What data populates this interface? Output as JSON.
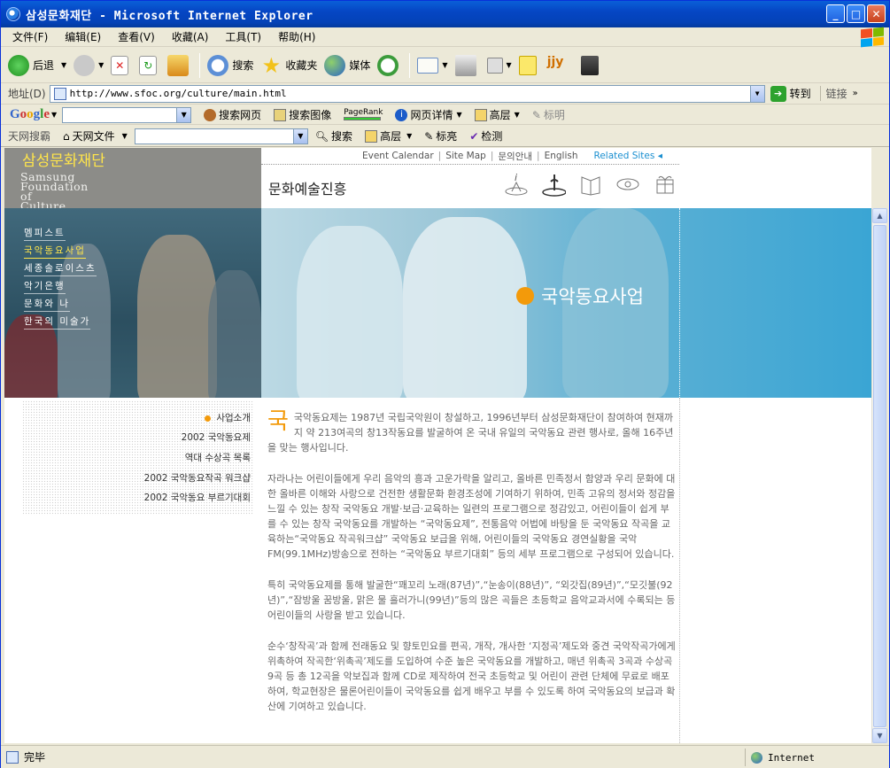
{
  "window": {
    "title": "삼성문화재단 - Microsoft Internet Explorer"
  },
  "menu": [
    "文件(F)",
    "编辑(E)",
    "查看(V)",
    "收藏(A)",
    "工具(T)",
    "帮助(H)"
  ],
  "toolbar": {
    "back": "后退",
    "search": "搜索",
    "favorites": "收藏夹",
    "media": "媒体"
  },
  "address": {
    "label": "地址(D)",
    "url": "http://www.sfoc.org/culture/main.html",
    "go": "转到",
    "links": "链接"
  },
  "google_bar": {
    "logo": "Google",
    "search_web": "搜索网页",
    "search_images": "搜索图像",
    "pagerank": "PageRank",
    "page_info": "网页详情",
    "up": "高层",
    "highlight": "标明"
  },
  "tianwang_bar": {
    "label": "天网搜霸",
    "files": "天网文件",
    "search": "搜索",
    "up": "高层",
    "highlight": "标亮",
    "check": "检测"
  },
  "site": {
    "logo_ko": "삼성문화재단",
    "logo_en": [
      "Samsung",
      "Foundation",
      "of",
      "Culture"
    ],
    "topnav": [
      "Event Calendar",
      "Site Map",
      "문의안내",
      "English"
    ],
    "related": "Related Sites",
    "section_title": "문화예술진흥",
    "left_nav": [
      "멤피스트",
      "국악동요사업",
      "세종솔로이스츠",
      "악기은행",
      "문화와 나",
      "한국의 미술가"
    ],
    "hero_caption": "국악동요사업",
    "submenu": [
      "사업소개",
      "2002 국악동요제",
      "역대 수상곡 목록",
      "2002 국악동요작곡 워크샵",
      "2002 국악동요 부르기대회"
    ],
    "dropcap": "국",
    "paragraphs": [
      "국악동요제는 1987년 국립국악원이 창설하고, 1996년부터 삼성문화재단이 참여하여 현재까지 약 213여곡의 창13작동요를 발굴하여 온 국내 유일의 국악동요 관련 행사로, 올해 16주년을 맞는 행사입니다.",
      "자라나는 어린이들에게 우리 음악의 흥과 고운가락을 알리고, 올바른 민족정서 함양과 우리 문화에 대한 올바른 이해와 사랑으로 건전한 생활문화 환경조성에 기여하기 위하여, 민족 고유의 정서와 정감을 느낄 수 있는 창작 국악동요 개발·보급·교육하는 일련의 프로그램으로 정감있고, 어린이들이 쉽게 부를 수 있는 창작 국악동요를 개발하는 “국악동요제”, 전통음악 어법에 바탕을 둔 국악동요 작곡을 교육하는“국악동요 작곡워크샵” 국악동요 보급을 위해, 어린이들의 국악동요 경연실황을 국악FM(99.1MHz)방송으로 전하는 “국악동요 부르기대회” 등의 세부 프로그램으로 구성되어 있습니다.",
      "특히 국악동요제를 통해 발굴한“꽤꼬리 노래(87년)”,“눈송이(88년)”, “외갓집(89년)”,“모깃불(92년)”,“잠방울 꿈방울, 맑은 물 흘러가니(99년)”등의 많은 곡들은 초등학교 음악교과서에 수록되는 등 어린이들의 사랑을 받고 있습니다.",
      "순수‘창작곡’과 함께 전래동요 및 향토민요를 편곡, 개작, 개사한 ‘지정곡’제도와 중견 국악작곡가에게 위촉하여 작곡한‘위촉곡’제도를 도입하여 수준 높은 국악동요를 개발하고, 매년 위촉곡 3곡과 수상곡 9곡 등 총 12곡을 악보집과 함께 CD로 제작하여 전국 초등학교 및 어린이 관련 단체에 무료로 배포하여, 학교현장은 물론어린이들이 국악동요를 쉽게 배우고 부를 수 있도록 하여 국악동요의 보급과 확산에 기여하고 있습니다."
    ]
  },
  "status": {
    "text": "完毕",
    "zone": "Internet"
  }
}
